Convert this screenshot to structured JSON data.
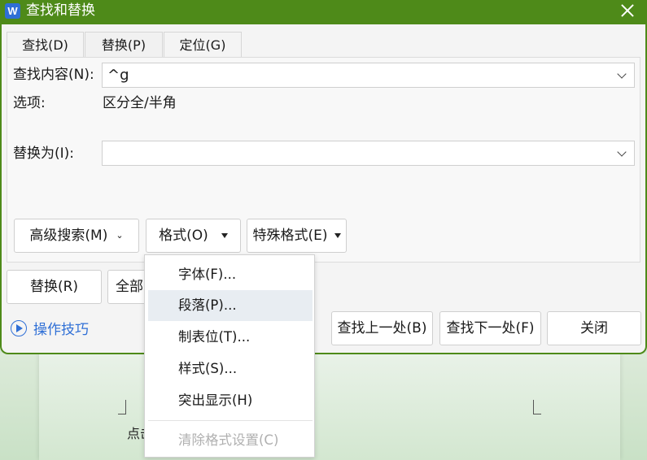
{
  "window": {
    "title": "查找和替换",
    "app_icon": "W",
    "accent": "#4e8a19"
  },
  "tabs": [
    {
      "label": "查找(D)",
      "active": false
    },
    {
      "label": "替换(P)",
      "active": true
    },
    {
      "label": "定位(G)",
      "active": false
    }
  ],
  "find": {
    "label": "查找内容(N):",
    "value": "^g"
  },
  "options": {
    "label": "选项:",
    "value": "区分全/半角"
  },
  "replace": {
    "label": "替换为(I):",
    "value": ""
  },
  "buttons": {
    "advanced": "高级搜索(M)",
    "format": "格式(O)",
    "special": "特殊格式(E)",
    "replace": "替换(R)",
    "replace_all": "全部",
    "find_prev": "查找上一处(B)",
    "find_next": "查找下一处(F)",
    "close": "关闭"
  },
  "tips": "操作技巧",
  "format_menu": [
    {
      "label": "字体(F)...",
      "hover": false,
      "disabled": false
    },
    {
      "label": "段落(P)...",
      "hover": true,
      "disabled": false
    },
    {
      "label": "制表位(T)...",
      "hover": false,
      "disabled": false
    },
    {
      "label": "样式(S)...",
      "hover": false,
      "disabled": false
    },
    {
      "label": "突出显示(H)",
      "hover": false,
      "disabled": false
    },
    {
      "label": "清除格式设置(C)",
      "hover": false,
      "disabled": true
    }
  ],
  "document": {
    "text_fragment": "点击"
  }
}
